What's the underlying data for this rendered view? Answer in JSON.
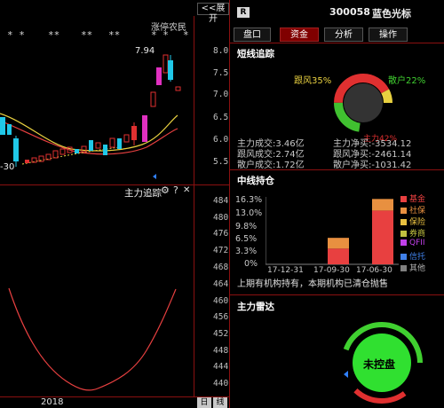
{
  "colors": {
    "up": "#e03030",
    "down": "#20c8e8",
    "ma1": "#e8d040",
    "ma2": "#e84040",
    "panel_border": "#8a1010",
    "active_tab": "#800000",
    "green_dot": "#40d030"
  },
  "chart": {
    "collapse_label": "<<展开",
    "limit_label": "涨停农民",
    "stars": [
      "* *",
      "**",
      "**",
      "**",
      "* *",
      "*"
    ],
    "high_label": "7.94",
    "low_label": "-30",
    "price_ticks": [
      "8.0",
      "7.5",
      "7.0",
      "6.5",
      "6.0",
      "5.5"
    ],
    "indicator_title": "主力追踪",
    "gear_icon": "⚙",
    "help_icon": "?",
    "close_icon": "✕",
    "indicator_ticks": [
      "484",
      "476",
      "468",
      "460",
      "452",
      "444",
      "436"
    ],
    "indicator_ticks_extra": [
      "480",
      "472",
      "464",
      "456",
      "448",
      "440"
    ],
    "year_label": "2018",
    "period_day": "日",
    "period_line": "线"
  },
  "header": {
    "badge": "R",
    "code": "300058",
    "name": "蓝色光标"
  },
  "tabs": [
    {
      "label": "盘口",
      "active": false
    },
    {
      "label": "资金",
      "active": true
    },
    {
      "label": "分析",
      "active": false
    },
    {
      "label": "操作",
      "active": false
    }
  ],
  "short_track": {
    "title": "短线追踪",
    "follow_label": "跟风35%",
    "retail_label": "散户22%",
    "main_label": "主力42%",
    "donut": [
      {
        "name": "主力",
        "value": 42,
        "color": "#e03030"
      },
      {
        "name": "跟风",
        "value": 35,
        "color": "#e8d040"
      },
      {
        "name": "散户",
        "value": 22,
        "color": "#40c030"
      }
    ],
    "rows": [
      {
        "left": "主力成交:3.46亿",
        "right": "主力净买:-3534.12"
      },
      {
        "left": "跟风成交:2.74亿",
        "right": "跟风净买:-2461.14"
      },
      {
        "left": "散户成交:1.72亿",
        "right": "散户净买:-1031.42"
      }
    ]
  },
  "mid_hold": {
    "title": "中线持仓",
    "y_ticks": [
      "16.3%",
      "13.0%",
      "9.8%",
      "6.5%",
      "3.3%",
      "0%"
    ],
    "x_labels": [
      "17-12-31",
      "17-09-30",
      "17-06-30"
    ],
    "legend": [
      {
        "label": "基金",
        "color": "#e84040"
      },
      {
        "label": "社保",
        "color": "#e89040"
      },
      {
        "label": "保险",
        "color": "#e8c040"
      },
      {
        "label": "券商",
        "color": "#c0c040"
      },
      {
        "label": "QFII",
        "color": "#c040e8"
      },
      {
        "label": "信托",
        "color": "#4080e8"
      },
      {
        "label": "其他",
        "color": "#808080"
      }
    ],
    "note": "上期有机构持有，本期机构已清仓抛售"
  },
  "chart_data": {
    "type": "bar",
    "categories": [
      "17-12-31",
      "17-09-30",
      "17-06-30"
    ],
    "series": [
      {
        "name": "基金",
        "values": [
          0,
          3.8,
          13.0
        ]
      },
      {
        "name": "社保",
        "values": [
          0,
          2.6,
          2.8
        ]
      }
    ],
    "ylim": [
      0,
      16.3
    ]
  },
  "radar": {
    "title": "主力雷达",
    "status": "未控盘"
  }
}
